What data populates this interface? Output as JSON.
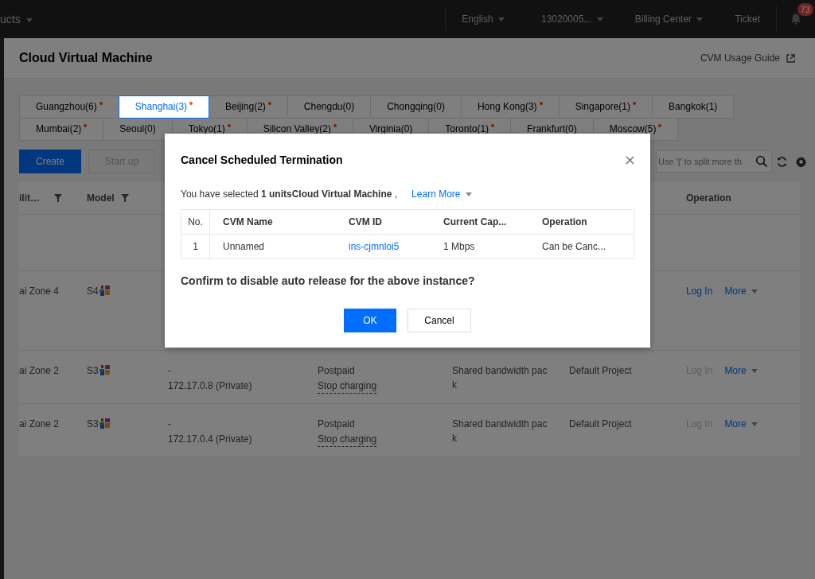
{
  "top_bar": {
    "products": "ucts",
    "language": "English",
    "account": "13020005...",
    "billing": "Billing Center",
    "ticket": "Ticket",
    "notification_count": "73"
  },
  "page": {
    "title": "Cloud Virtual Machine",
    "guide_link": "CVM Usage Guide"
  },
  "region_tab_rows": [
    {
      "tabs": [
        {
          "label": "Guangzhou(6)",
          "selected": false,
          "alert": true
        },
        {
          "label": "Shanghai(3)",
          "selected": true,
          "alert": true
        },
        {
          "label": "Beijing(2)",
          "selected": false,
          "alert": true
        },
        {
          "label": "Chengdu(0)",
          "selected": false,
          "alert": false
        },
        {
          "label": "Chongqing(0)",
          "selected": false,
          "alert": false
        },
        {
          "label": "Hong Kong(3)",
          "selected": false,
          "alert": true
        },
        {
          "label": "Singapore(1)",
          "selected": false,
          "alert": true
        },
        {
          "label": "Bangkok(1)",
          "selected": false,
          "alert": false
        }
      ]
    },
    {
      "tabs": [
        {
          "label": "Mumbai(2)",
          "selected": false,
          "alert": true
        },
        {
          "label": "Seoul(0)",
          "selected": false,
          "alert": false
        },
        {
          "label": "Tokyo(1)",
          "selected": false,
          "alert": true
        },
        {
          "label": "Silicon Valley(2)",
          "selected": false,
          "alert": true
        },
        {
          "label": "Virginia(0)",
          "selected": false,
          "alert": false
        },
        {
          "label": "Toronto(1)",
          "selected": false,
          "alert": true
        },
        {
          "label": "Frankfurt(0)",
          "selected": false,
          "alert": false
        },
        {
          "label": "Moscow(5)",
          "selected": false,
          "alert": true
        }
      ]
    }
  ],
  "toolbar": {
    "buttons": [
      {
        "label": "Create",
        "kind": "primary",
        "disabled": false
      },
      {
        "label": "Start up",
        "kind": "default",
        "disabled": true
      }
    ],
    "search": {
      "placeholder": "Use '|' to split more th"
    }
  },
  "table": {
    "columns": [
      {
        "label": "ilit…",
        "filter": true
      },
      {
        "label": "Model",
        "filter": true
      },
      {
        "label": "Operation"
      }
    ],
    "rows": [
      {
        "zone": "ai Zone 4",
        "model": "S4",
        "login": {
          "label": "Log In",
          "disabled": false
        },
        "more": "More"
      },
      {
        "zone": "ai Zone 2",
        "model": "S3",
        "ip_public": "-",
        "ip_private": "172.17.0.8 (Private)",
        "billing": "Postpaid",
        "billing_action": "Stop charging",
        "bandwidth": "Shared bandwidth pack",
        "project": "Default Project",
        "login": {
          "label": "Log In",
          "disabled": true
        },
        "more": "More"
      },
      {
        "zone": "ai Zone 2",
        "model": "S3",
        "ip_public": "-",
        "ip_private": "172.17.0.4 (Private)",
        "billing": "Postpaid",
        "billing_action": "Stop charging",
        "bandwidth": "Shared bandwidth pack",
        "project": "Default Project",
        "login": {
          "label": "Log In",
          "disabled": true
        },
        "more": "More"
      }
    ]
  },
  "dialog": {
    "title": "Cancel Scheduled Termination",
    "summary": "You have selected **1 unitsCloud Virtual Machine** ,",
    "learn_more": "Learn More",
    "columns": [
      "No.",
      "CVM Name",
      "CVM ID",
      "Current Cap...",
      "Operation"
    ],
    "rows": [
      {
        "no": "1",
        "name": "Unnamed",
        "id": "ins-cjmnloi5",
        "capacity": "1 Mbps",
        "operation": "Can be Canc..."
      }
    ],
    "question": "Confirm to disable auto release for the above instance?",
    "buttons": [
      {
        "label": "OK",
        "kind": "primary"
      },
      {
        "label": "Cancel",
        "kind": "default"
      }
    ]
  }
}
